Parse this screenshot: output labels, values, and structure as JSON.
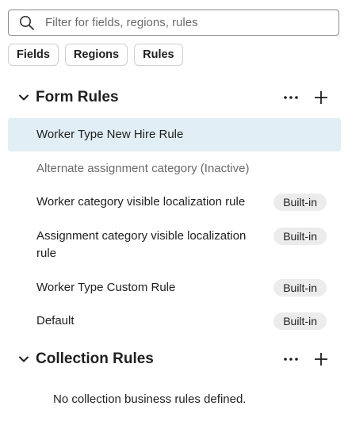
{
  "search": {
    "placeholder": "Filter for fields, regions, rules"
  },
  "filters": {
    "fields": "Fields",
    "regions": "Regions",
    "rules": "Rules"
  },
  "form_rules": {
    "title": "Form Rules",
    "items": [
      {
        "label": "Worker Type New Hire Rule",
        "badge": ""
      },
      {
        "label": "Alternate assignment category (Inactive)",
        "badge": ""
      },
      {
        "label": "Worker category visible localization rule",
        "badge": "Built-in"
      },
      {
        "label": "Assignment category visible localization rule",
        "badge": "Built-in"
      },
      {
        "label": "Worker Type Custom Rule",
        "badge": "Built-in"
      },
      {
        "label": "Default",
        "badge": "Built-in"
      }
    ]
  },
  "collection_rules": {
    "title": "Collection Rules",
    "empty_message": "No collection business rules defined."
  },
  "icons": {
    "search": "search-icon",
    "chevron": "chevron-down-icon",
    "more": "more-horizontal-icon",
    "add": "plus-icon"
  },
  "colors": {
    "selected_row": "#e1eef5",
    "badge_bg": "#ececec",
    "inactive_text": "#6a6a6a"
  }
}
